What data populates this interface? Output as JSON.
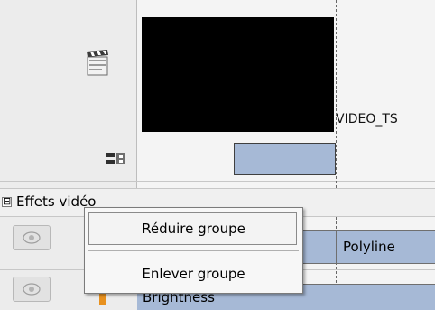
{
  "timeline": {
    "clip_label": "VIDEO_TS",
    "icons": {
      "media_track": "clapperboard-icon",
      "transition_track": "transition-icon",
      "visibility": "eye-icon"
    }
  },
  "group": {
    "toggle_symbol": "⊟",
    "label": "Effets vidéo"
  },
  "tracks": [
    {
      "label": "Polyline"
    },
    {
      "label": "Brightness"
    }
  ],
  "context_menu": {
    "items": [
      {
        "label": "Réduire groupe"
      },
      {
        "label": "Enlever groupe"
      }
    ]
  },
  "colors": {
    "track_fill": "#a6b9d6",
    "panel_bg": "#ececec",
    "highlight": "#e8911e"
  }
}
